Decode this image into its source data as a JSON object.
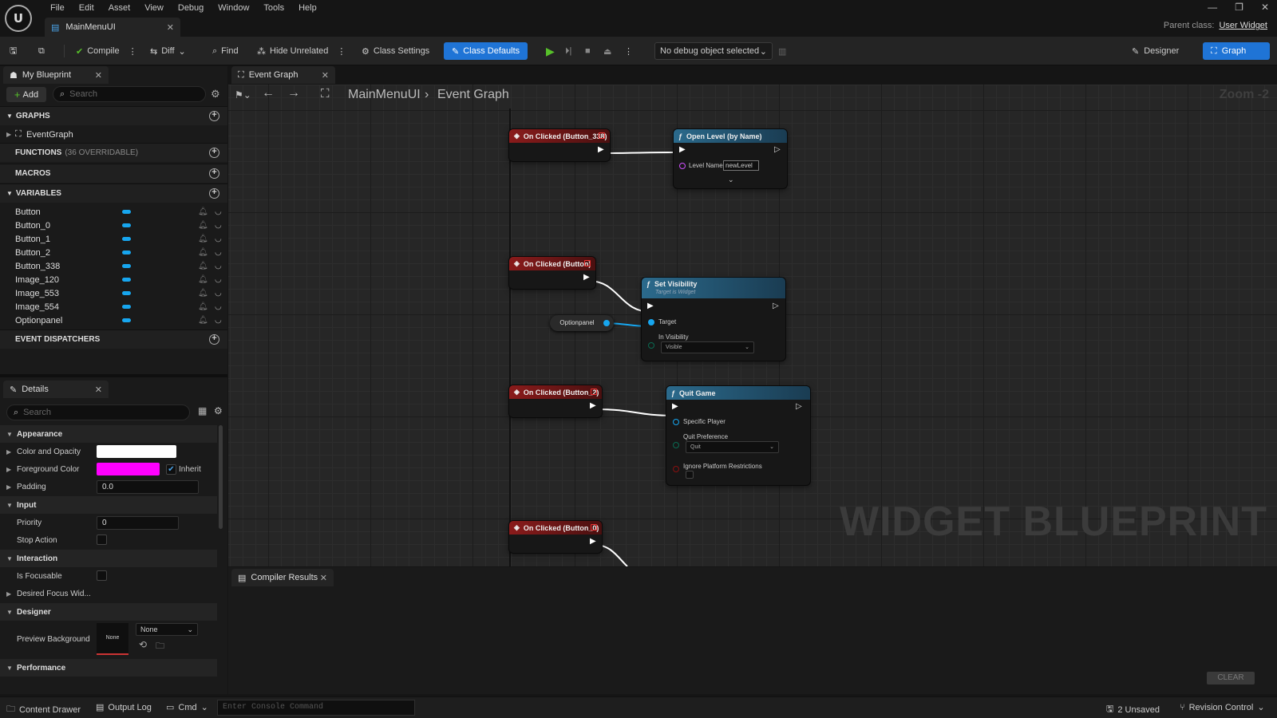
{
  "menu": [
    "File",
    "Edit",
    "Asset",
    "View",
    "Debug",
    "Window",
    "Tools",
    "Help"
  ],
  "doc_tab": "MainMenuUI",
  "parent_class_label": "Parent class:",
  "parent_class_value": "User Widget",
  "toolbar": {
    "compile": "Compile",
    "diff": "Diff",
    "find": "Find",
    "hide_unrelated": "Hide Unrelated",
    "class_settings": "Class Settings",
    "class_defaults": "Class Defaults",
    "debug_object": "No debug object selected",
    "designer": "Designer",
    "graph": "Graph"
  },
  "my_blueprint": {
    "tab": "My Blueprint",
    "add": "Add",
    "search_placeholder": "Search",
    "graphs": "GRAPHS",
    "event_graph": "EventGraph",
    "functions": "FUNCTIONS",
    "functions_count": "(36 OVERRIDABLE)",
    "macros": "MACROS",
    "variables": "VARIABLES",
    "variable_list": [
      "Button",
      "Button_0",
      "Button_1",
      "Button_2",
      "Button_338",
      "Image_120",
      "Image_553",
      "Image_554",
      "Optionpanel"
    ],
    "event_dispatchers": "EVENT DISPATCHERS"
  },
  "details": {
    "tab": "Details",
    "search_placeholder": "Search",
    "appearance": "Appearance",
    "color_opacity": "Color and Opacity",
    "foreground_color": "Foreground Color",
    "inherit": "Inherit",
    "padding": "Padding",
    "padding_value": "0.0",
    "input": "Input",
    "priority": "Priority",
    "priority_value": "0",
    "stop_action": "Stop Action",
    "interaction": "Interaction",
    "is_focusable": "Is Focusable",
    "desired_focus": "Desired Focus Wid...",
    "designer": "Designer",
    "preview_background": "Preview Background",
    "preview_none": "None",
    "preview_select": "None",
    "performance": "Performance",
    "colors": {
      "color_opacity": "#ffffff",
      "foreground": "#ff00ff"
    }
  },
  "event_graph": {
    "tab": "Event Graph",
    "crumb_root": "MainMenuUI",
    "crumb_leaf": "Event Graph",
    "zoom": "Zoom -2",
    "watermark": "WIDGET BLUEPRINT",
    "nodes": {
      "ev1": "On Clicked (Button_338)",
      "open_level": "Open Level (by Name)",
      "level_name_label": "Level Name",
      "level_name_value": "newLevel",
      "ev2": "On Clicked (Button)",
      "set_vis": "Set Visibility",
      "set_vis_sub": "Target is Widget",
      "optionpanel": "Optionpanel",
      "target": "Target",
      "in_visibility": "In Visibility",
      "visible": "Visible",
      "ev3": "On Clicked (Button_2)",
      "quit_game": "Quit Game",
      "specific_player": "Specific Player",
      "quit_preference": "Quit Preference",
      "quit": "Quit",
      "ignore_platform": "Ignore Platform Restrictions",
      "ev4": "On Clicked (Button_0)"
    }
  },
  "compiler": {
    "tab": "Compiler Results",
    "clear": "CLEAR"
  },
  "statusbar": {
    "content_drawer": "Content Drawer",
    "output_log": "Output Log",
    "cmd": "Cmd",
    "console_placeholder": "Enter Console Command",
    "unsaved": "2 Unsaved",
    "revision": "Revision Control"
  }
}
